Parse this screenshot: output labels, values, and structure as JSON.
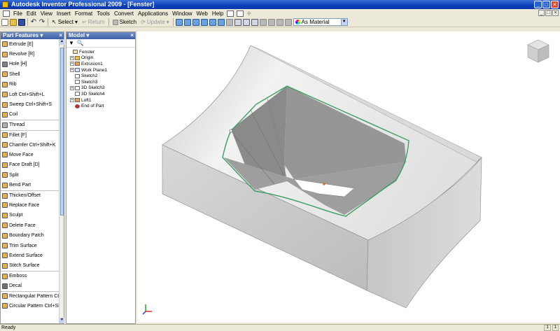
{
  "window": {
    "title": "Autodesk Inventor Professional 2009 - [Fenster]"
  },
  "menu": [
    "File",
    "Edit",
    "View",
    "Insert",
    "Format",
    "Tools",
    "Convert",
    "Applications",
    "Window",
    "Web",
    "Help"
  ],
  "toolbar": {
    "select_label": "Select",
    "return_label": "Return",
    "sketch_label": "Sketch",
    "update_label": "Update",
    "material_value": "As Material"
  },
  "part_features": {
    "title": "Part Features",
    "commands": [
      {
        "label": "Extrude   [E]",
        "color": "#e8b050"
      },
      {
        "label": "Revolve   [R]",
        "color": "#e8b050"
      },
      {
        "label": "Hole   [H]",
        "color": "#808080"
      },
      {
        "label": "Shell",
        "color": "#e8b050"
      },
      {
        "label": "Rib",
        "color": "#e8b050"
      },
      {
        "label": "Loft   Ctrl+Shift+L",
        "color": "#e8b050"
      },
      {
        "label": "Sweep   Ctrl+Shift+S",
        "color": "#e8b050"
      },
      {
        "label": "Coil",
        "color": "#e8b050"
      },
      {
        "label": "Thread",
        "color": "#b0b0b0",
        "sep": true
      },
      {
        "label": "Fillet   [F]",
        "color": "#e8b050",
        "sep": true
      },
      {
        "label": "Chamfer   Ctrl+Shift+K",
        "color": "#e8b050"
      },
      {
        "label": "Move Face",
        "color": "#e8b050"
      },
      {
        "label": "Face Draft   [D]",
        "color": "#e8b050"
      },
      {
        "label": "Split",
        "color": "#e8b050"
      },
      {
        "label": "Bend Part",
        "color": "#e8b050"
      },
      {
        "label": "Thicken/Offset",
        "color": "#e8b050",
        "sep": true
      },
      {
        "label": "Replace Face",
        "color": "#e8b050"
      },
      {
        "label": "Sculpt",
        "color": "#e8b050"
      },
      {
        "label": "Delete Face",
        "color": "#e8b050"
      },
      {
        "label": "Boundary Patch",
        "color": "#e8b050"
      },
      {
        "label": "Trim Surface",
        "color": "#e8b050"
      },
      {
        "label": "Extend Surface",
        "color": "#e8b050"
      },
      {
        "label": "Stitch Surface",
        "color": "#e8b050"
      },
      {
        "label": "Emboss",
        "color": "#e8b050",
        "sep": true
      },
      {
        "label": "Decal",
        "color": "#707070"
      },
      {
        "label": "Rectangular Pattern   Ctrl+Shift+R",
        "color": "#e8b050",
        "sep": true
      },
      {
        "label": "Circular Pattern   Ctrl+Shift+O",
        "color": "#e8b050"
      }
    ]
  },
  "model": {
    "title": "Model",
    "tree": [
      {
        "label": "Fenster",
        "indent": 0,
        "exp": "",
        "icon": "part"
      },
      {
        "label": "Origin",
        "indent": 1,
        "exp": "+",
        "icon": "folder"
      },
      {
        "label": "Extrusion1",
        "indent": 1,
        "exp": "+",
        "icon": "feat"
      },
      {
        "label": "Work Plane1",
        "indent": 1,
        "exp": "+",
        "icon": "plane"
      },
      {
        "label": "Sketch2",
        "indent": 1,
        "exp": "",
        "icon": "sketch"
      },
      {
        "label": "Sketch3",
        "indent": 1,
        "exp": "",
        "icon": "sketch"
      },
      {
        "label": "3D Sketch3",
        "indent": 1,
        "exp": "+",
        "icon": "sketch"
      },
      {
        "label": "3D Sketch4",
        "indent": 1,
        "exp": "",
        "icon": "sketch"
      },
      {
        "label": "Loft1",
        "indent": 1,
        "exp": "+",
        "icon": "feat"
      },
      {
        "label": "End of Part",
        "indent": 1,
        "exp": "",
        "icon": "end"
      }
    ]
  },
  "status": {
    "text": "Ready",
    "cells": [
      "1",
      "1"
    ]
  },
  "colors": {
    "face_light": "#e6e6e6",
    "face_mid": "#cfcfcf",
    "face_dark": "#a8a8a8",
    "edge_highlight": "#3aa060"
  }
}
